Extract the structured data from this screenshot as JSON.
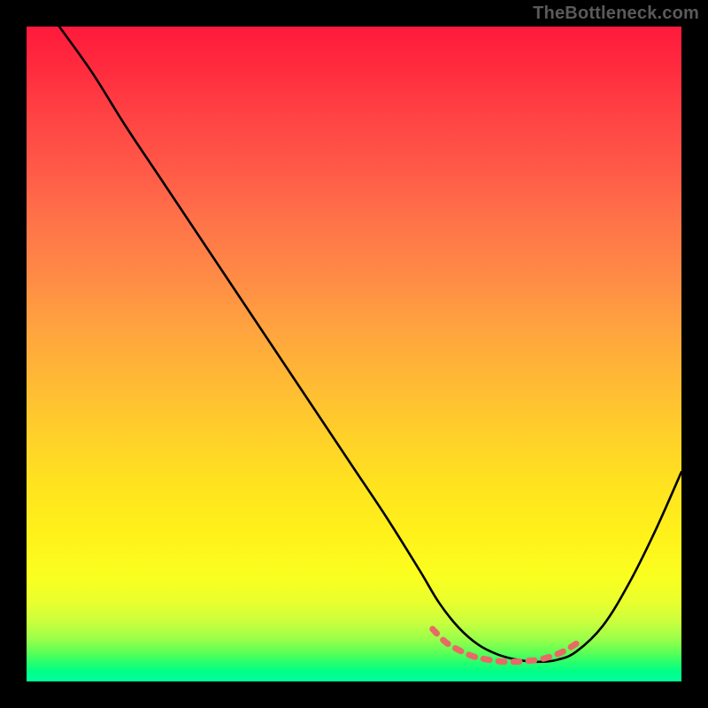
{
  "watermark": "TheBottleneck.com",
  "chart_data": {
    "type": "line",
    "title": "",
    "xlabel": "",
    "ylabel": "",
    "xlim": [
      0,
      100
    ],
    "ylim": [
      0,
      100
    ],
    "grid": false,
    "series": [
      {
        "name": "main-curve",
        "color": "#000000",
        "x": [
          5,
          10,
          15,
          20,
          25,
          30,
          35,
          40,
          45,
          50,
          55,
          60,
          63,
          66,
          69,
          72,
          75,
          78,
          81,
          84,
          88,
          92,
          96,
          100
        ],
        "y": [
          100,
          93,
          85,
          77.5,
          70,
          62.5,
          55,
          47.5,
          40,
          32.5,
          25,
          17,
          12,
          8.2,
          5.6,
          4.1,
          3.3,
          3.0,
          3.3,
          4.6,
          8.5,
          15,
          23,
          32
        ]
      },
      {
        "name": "trough-overlay",
        "color": "#e86a66",
        "x": [
          62,
          64,
          66,
          68,
          70,
          72,
          74,
          76,
          78,
          80,
          82,
          84
        ],
        "y": [
          8.0,
          6.0,
          4.8,
          3.9,
          3.4,
          3.1,
          3.0,
          3.1,
          3.3,
          3.8,
          4.6,
          5.8
        ]
      }
    ],
    "gradient_stops": [
      {
        "pos": 0.0,
        "color": "#ff1a3c"
      },
      {
        "pos": 0.25,
        "color": "#ff7a48"
      },
      {
        "pos": 0.5,
        "color": "#ffc22e"
      },
      {
        "pos": 0.75,
        "color": "#fff01c"
      },
      {
        "pos": 0.92,
        "color": "#b3ff45"
      },
      {
        "pos": 1.0,
        "color": "#00ff9c"
      }
    ]
  }
}
